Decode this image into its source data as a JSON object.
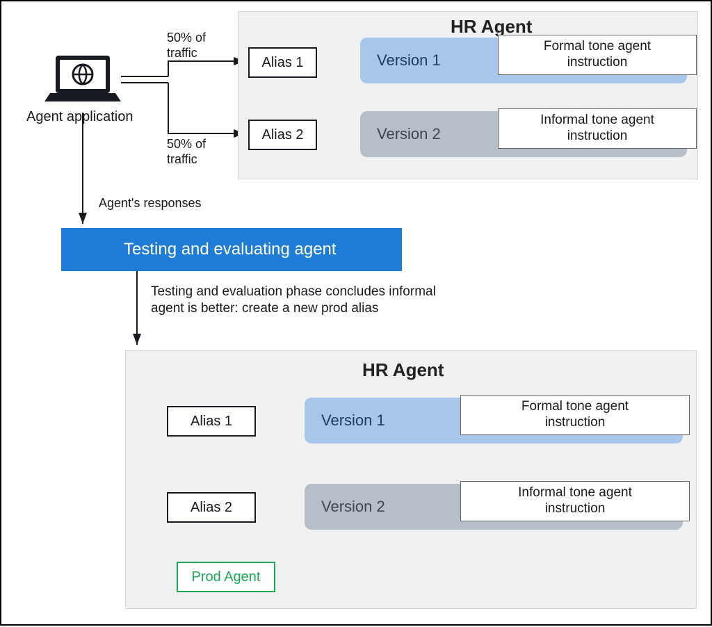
{
  "app_label": "Agent application",
  "traffic_label_top": "50% of\ntraffic",
  "traffic_label_bottom": "50% of\ntraffic",
  "responses_label": "Agent's responses",
  "eval_bar_label": "Testing and evaluating agent",
  "conclusion_note": "Testing and evaluation phase concludes informal\nagent is better: create a new prod alias",
  "top_panel": {
    "title": "HR Agent",
    "alias1": "Alias 1",
    "alias2": "Alias 2",
    "version1": "Version 1",
    "version2": "Version 2",
    "inst1": "Formal tone agent\ninstruction",
    "inst2": "Informal tone agent\ninstruction"
  },
  "bottom_panel": {
    "title": "HR Agent",
    "alias1": "Alias 1",
    "alias2": "Alias 2",
    "version1": "Version 1",
    "version2": "Version 2",
    "inst1": "Formal tone agent\ninstruction",
    "inst2": "Informal tone agent\ninstruction",
    "prod": "Prod Agent"
  }
}
